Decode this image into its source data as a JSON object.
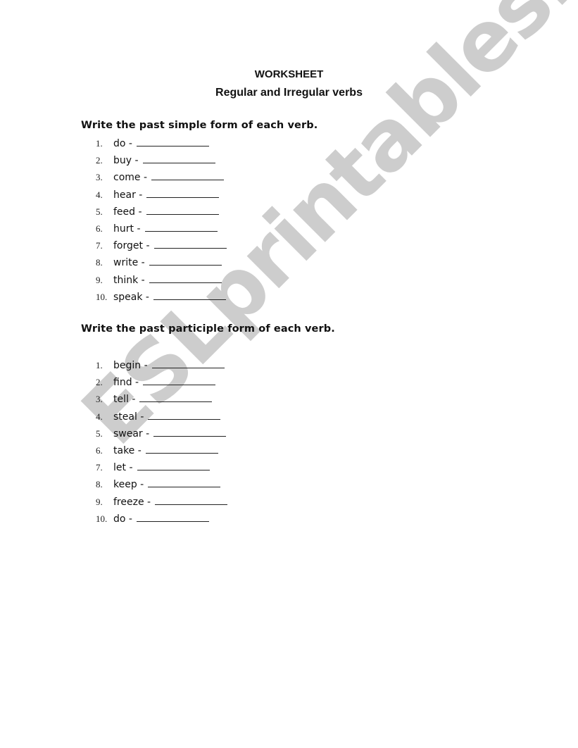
{
  "header": {
    "title": "WORKSHEET",
    "subtitle": "Regular and Irregular verbs"
  },
  "sections": [
    {
      "instruction": "Write the past simple form of each verb.",
      "items": [
        {
          "num": "1.",
          "verb": "do -"
        },
        {
          "num": "2.",
          "verb": "buy -"
        },
        {
          "num": "3.",
          "verb": "come -"
        },
        {
          "num": "4.",
          "verb": "hear -"
        },
        {
          "num": "5.",
          "verb": "feed -"
        },
        {
          "num": "6.",
          "verb": "hurt -"
        },
        {
          "num": "7.",
          "verb": "forget -"
        },
        {
          "num": "8.",
          "verb": "write -"
        },
        {
          "num": "9.",
          "verb": "think -"
        },
        {
          "num": "10.",
          "verb": "speak -"
        }
      ]
    },
    {
      "instruction": "Write the past participle form of each verb.",
      "items": [
        {
          "num": "1.",
          "verb": "begin -"
        },
        {
          "num": "2.",
          "verb": "find -"
        },
        {
          "num": "3.",
          "verb": "tell -"
        },
        {
          "num": "4.",
          "verb": "steal -"
        },
        {
          "num": "5.",
          "verb": "swear -"
        },
        {
          "num": "6.",
          "verb": "take -"
        },
        {
          "num": "7.",
          "verb": "let -"
        },
        {
          "num": "8.",
          "verb": "keep -"
        },
        {
          "num": "9.",
          "verb": "freeze -"
        },
        {
          "num": "10.",
          "verb": "do -"
        }
      ]
    }
  ],
  "watermark": "ESLprintables.com"
}
